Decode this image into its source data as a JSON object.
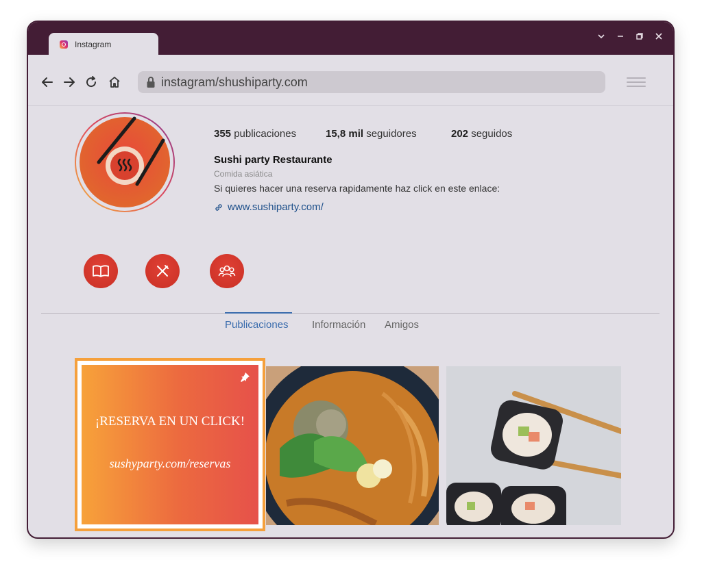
{
  "browser": {
    "tab_title": "Instagram",
    "url": "instagram/shushiparty.com",
    "window_controls": [
      "chevron-down-icon",
      "minimize-icon",
      "restore-icon",
      "close-icon"
    ]
  },
  "profile": {
    "stats": [
      {
        "value": "355",
        "label": "publicaciones"
      },
      {
        "value": "15,8 mil",
        "label": "seguidores"
      },
      {
        "value": "202",
        "label": "seguidos"
      }
    ],
    "name": "Sushi party Restaurante",
    "category": "Comida asiática",
    "bio": "Si quieres hacer una reserva rapidamente haz click en este enlace:",
    "link": "www.sushiparty.com/"
  },
  "highlights": [
    {
      "icon": "book-icon"
    },
    {
      "icon": "utensils-icon"
    },
    {
      "icon": "group-icon"
    }
  ],
  "tabs": [
    {
      "label": "Publicaciones",
      "active": true
    },
    {
      "label": "Información",
      "active": false
    },
    {
      "label": "Amigos",
      "active": false
    }
  ],
  "posts": {
    "pinned": {
      "title": "¡RESERVA EN UN CLICK!",
      "url": "sushyparty.com/reservas"
    }
  },
  "colors": {
    "titlebar": "#431d35",
    "accent": "#3a6cad",
    "brand_red": "#d9402f",
    "pinned_border": "#f5a03c"
  }
}
